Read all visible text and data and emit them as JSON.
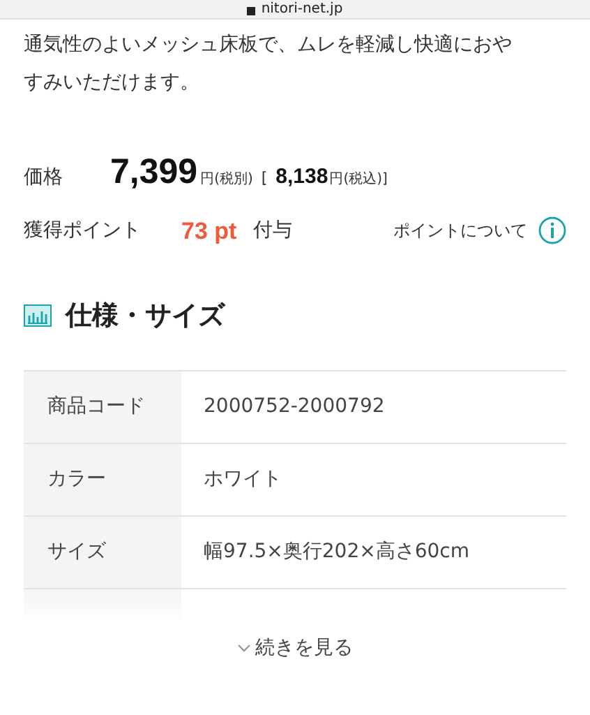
{
  "address_bar": {
    "url": "nitori-net.jp"
  },
  "description": "通気性のよいメッシュ床板で、ムレを軽減し快適におやすみいただけます。",
  "price": {
    "label": "価格",
    "amount": "7,399",
    "unit": "円(税別)",
    "bracket_open": "[",
    "tax_amount": "8,138",
    "tax_unit": "円(税込)]"
  },
  "points": {
    "label": "獲得ポイント",
    "value": "73 pt",
    "suffix": "付与",
    "link": "ポイントについて"
  },
  "section": {
    "title": "仕様・サイズ"
  },
  "specs": [
    {
      "name": "商品コード",
      "value": "2000752-2000792"
    },
    {
      "name": "カラー",
      "value": "ホワイト"
    },
    {
      "name": "サイズ",
      "value": "幅97.5×奥行202×高さ60cm"
    }
  ],
  "more_button": {
    "label": "続きを見る"
  }
}
